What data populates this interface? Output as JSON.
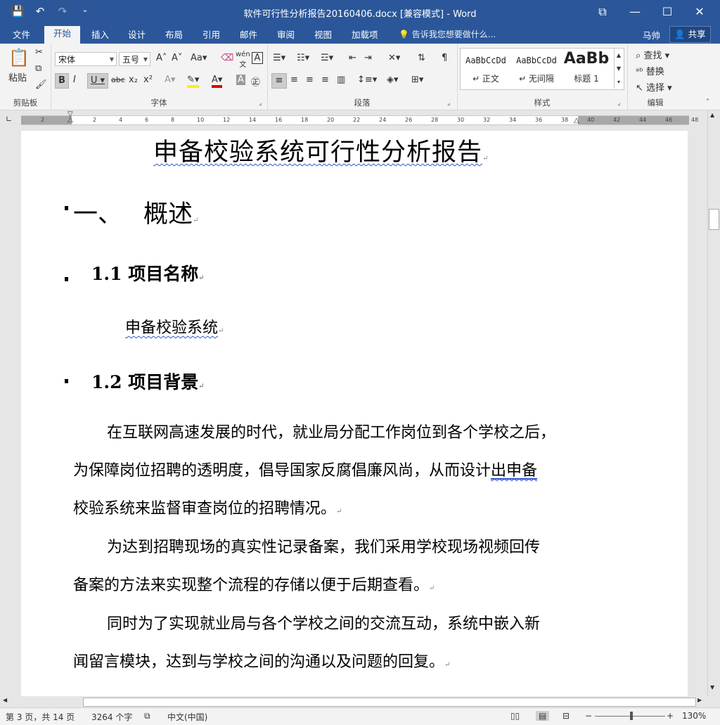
{
  "app": {
    "window_title": "软件可行性分析报告20160406.docx [兼容模式] - Word",
    "qat": [
      "💾",
      "↶",
      "↷",
      "⌄"
    ],
    "win_controls": [
      "⧉",
      "—",
      "☐",
      "✕"
    ]
  },
  "tabs": [
    "文件",
    "开始",
    "插入",
    "设计",
    "布局",
    "引用",
    "邮件",
    "审阅",
    "视图",
    "加载项"
  ],
  "tell_me": "告诉我您想要做什么...",
  "user": "马帅",
  "share": "共享",
  "ribbon": {
    "clipboard": {
      "paste": "粘贴",
      "label": "剪贴板"
    },
    "font": {
      "name": "宋体",
      "size": "五号",
      "label": "字体"
    },
    "paragraph": {
      "label": "段落"
    },
    "styles": {
      "label": "样式",
      "items": [
        {
          "sample": "AaBbCcDd",
          "name": "↵ 正文"
        },
        {
          "sample": "AaBbCcDd",
          "name": "↵ 无间隔"
        },
        {
          "sample": "AaBb",
          "name": "标题 1"
        }
      ]
    },
    "editing": {
      "find": "查找",
      "replace": "替换",
      "select": "选择",
      "label": "编辑"
    }
  },
  "ruler_numbers": [
    "2",
    "",
    "2",
    "4",
    "6",
    "8",
    "10",
    "12",
    "14",
    "16",
    "18",
    "20",
    "22",
    "24",
    "26",
    "28",
    "30",
    "32",
    "34",
    "36",
    "38",
    "40",
    "42",
    "44",
    "46",
    "48"
  ],
  "doc": {
    "title": "申备校验系统可行性分析报告",
    "h1_num": "一、",
    "h1_text": "概述",
    "h2_1": "1.1 项目名称",
    "project_name": "申备校验系统",
    "h2_2": "1.2 项目背景",
    "p1": [
      "在互联网高速发展的时代，就业局分配工作岗位到各个学校之后，",
      "为保障岗位招聘的透明度，倡导国家反腐倡廉风尚，从而设计",
      "出申备",
      "校验系统来监督审查岗位的招聘情况。"
    ],
    "p2": [
      "为达到招聘现场的真实性记录备案，我们采用学校现场视频回传",
      "备案的方法来实现整个流程的存储以便于后期查看。"
    ],
    "p3": [
      "同时为了实现就业局与各个学校之间的交流互动，系统中嵌入新",
      "闻留言模块，达到与学校之间的沟通以及问题的回复。"
    ],
    "para_mark": "↵"
  },
  "status": {
    "page": "第 3 页，共 14 页",
    "words": "3264 个字",
    "lang": "中文(中国)",
    "zoom": "130%"
  }
}
